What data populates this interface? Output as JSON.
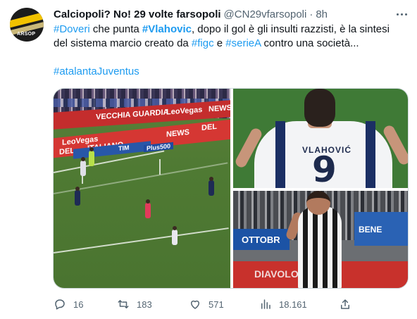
{
  "user": {
    "display_name": "Calciopoli? No! 29 volte farsopoli",
    "handle": "@CN29vfarsopoli",
    "separator": "·",
    "time": "8h",
    "avatar_text": "ARSOP"
  },
  "tweet": {
    "line1": [
      {
        "t": "#Doveri",
        "style": "tag"
      },
      {
        "t": " che punta ",
        "style": "plain"
      },
      {
        "t": "#Vlahovic",
        "style": "tagb"
      },
      {
        "t": ", dopo il gol è gli insulti razzisti, è la sintesi",
        "style": "plain"
      }
    ],
    "line2": [
      {
        "t": "del sistema marcio creato da ",
        "style": "plain"
      },
      {
        "t": "#figc",
        "style": "tag"
      },
      {
        "t": " e ",
        "style": "plain"
      },
      {
        "t": "#serieA",
        "style": "tag"
      },
      {
        "t": " contro una società...",
        "style": "plain"
      }
    ],
    "hashtag_line": "#atalantaJuventus"
  },
  "media": {
    "left": {
      "ad1": "LeoVegas",
      "ad2": "NEWS",
      "ad3": "VECCHIA GUARDIA",
      "ad4": "DEL",
      "ad5": "ITALIANO",
      "ad6": "LeoVegas",
      "ad7": "NEWS",
      "ad8": "DEL",
      "ad9": "TIM",
      "ad10": "Plus500"
    },
    "top_right": {
      "jersey_name": "VLAHOVIĆ",
      "jersey_number": "9"
    },
    "bottom_right": {
      "banner1": "OTTOBR",
      "banner2": "BENE",
      "banner3": "DIAVOLO"
    }
  },
  "actions": {
    "reply_count": "16",
    "retweet_count": "183",
    "like_count": "571",
    "views_count": "18.161"
  },
  "colors": {
    "link": "#1d9bf0",
    "muted": "#536471",
    "text": "#0f1419"
  }
}
